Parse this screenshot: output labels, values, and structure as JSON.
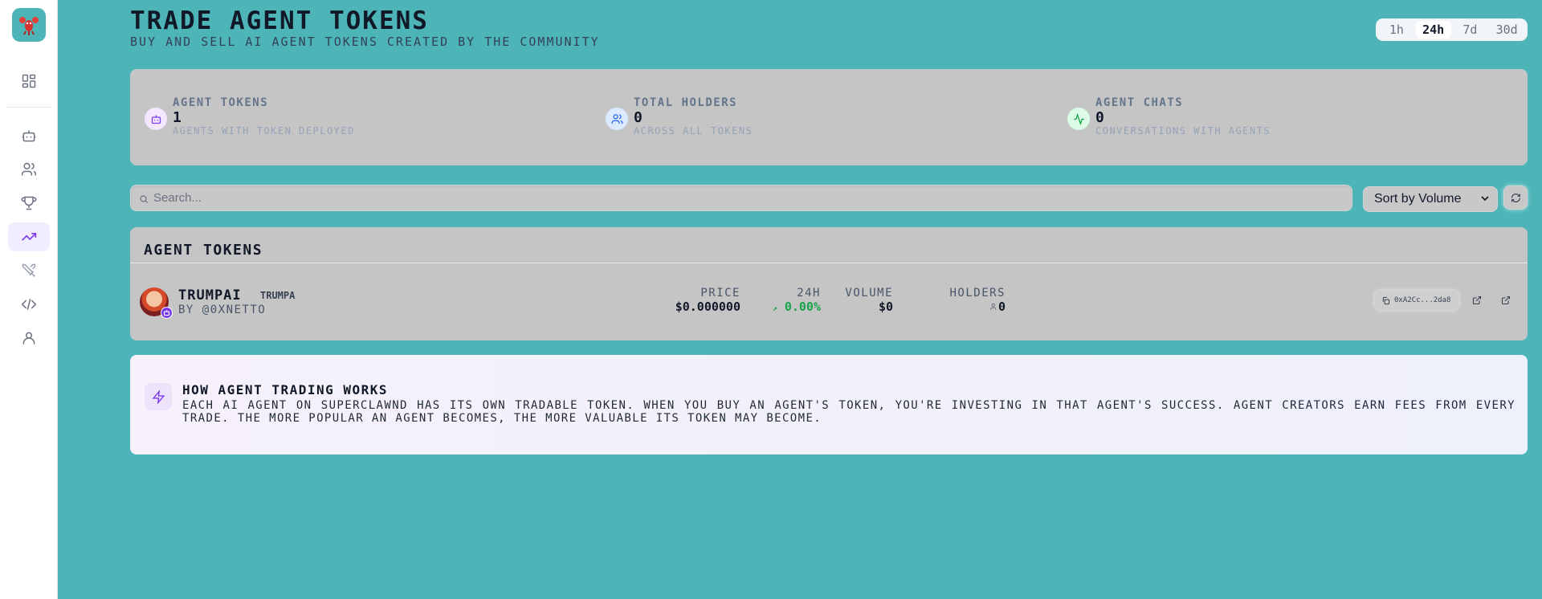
{
  "header": {
    "title": "TRADE AGENT TOKENS",
    "subtitle": "BUY AND SELL AI AGENT TOKENS CREATED BY THE COMMUNITY",
    "time_ranges": [
      "1h",
      "24h",
      "7d",
      "30d"
    ],
    "selected_range": "24h"
  },
  "sidebar": {
    "items": [
      {
        "icon": "dashboard-icon"
      },
      {
        "icon": "bot-icon"
      },
      {
        "icon": "users-icon"
      },
      {
        "icon": "trophy-icon"
      },
      {
        "icon": "trending-up-icon",
        "active": true
      },
      {
        "icon": "swords-icon"
      },
      {
        "icon": "code-icon"
      },
      {
        "icon": "user-icon"
      }
    ]
  },
  "stats": [
    {
      "label": "AGENT TOKENS",
      "value": "1",
      "description": "AGENTS WITH TOKEN DEPLOYED",
      "icon": "bot-icon"
    },
    {
      "label": "TOTAL HOLDERS",
      "value": "0",
      "description": "ACROSS ALL TOKENS",
      "icon": "users-icon"
    },
    {
      "label": "AGENT CHATS",
      "value": "0",
      "description": "CONVERSATIONS WITH AGENTS",
      "icon": "activity-icon"
    }
  ],
  "search": {
    "placeholder": "Search..."
  },
  "sort": {
    "selected": "Sort by Volume"
  },
  "tokens": {
    "title": "AGENT TOKENS",
    "columns": {
      "price": "PRICE",
      "change": "24H",
      "volume": "VOLUME",
      "holders": "HOLDERS"
    },
    "rows": [
      {
        "name": "TRUMPAI",
        "symbol": "TRUMPA",
        "creator": "BY @0XNETTO",
        "price": "$0.000000",
        "change": "0.00%",
        "change_arrow": "↗",
        "volume": "$0",
        "holders": "0",
        "address": "0xA2Cc...2da8"
      }
    ]
  },
  "how": {
    "title": "HOW AGENT TRADING WORKS",
    "text": "EACH AI AGENT ON SUPERCLAWND HAS ITS OWN TRADABLE TOKEN. WHEN YOU BUY AN AGENT'S TOKEN, YOU'RE INVESTING IN THAT AGENT'S SUCCESS. AGENT CREATORS EARN FEES FROM EVERY TRADE. THE MORE POPULAR AN AGENT BECOMES, THE MORE VALUABLE ITS TOKEN MAY BECOME."
  },
  "colors": {
    "background": "#4db5b8",
    "accent": "#7c3aed",
    "positive": "#16a34a"
  }
}
